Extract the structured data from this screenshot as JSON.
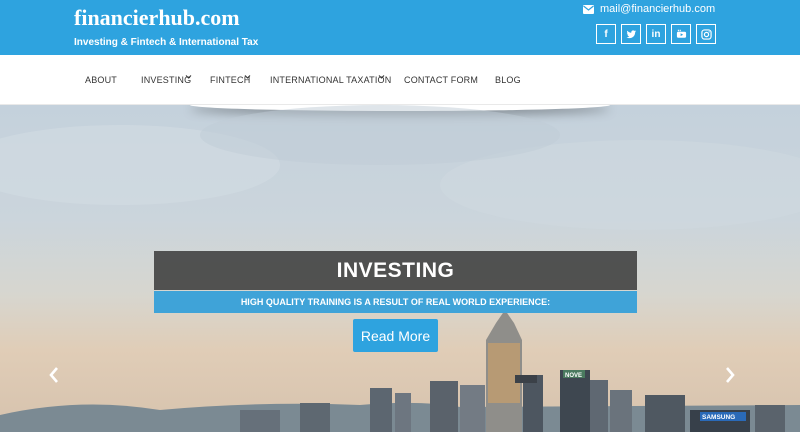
{
  "header": {
    "site_title": "financierhub.com",
    "tagline": "Investing & Fintech & International Tax",
    "email": "mail@financierhub.com",
    "socials": [
      {
        "name": "facebook-icon",
        "glyph": "f"
      },
      {
        "name": "twitter-icon",
        "glyph": ""
      },
      {
        "name": "linkedin-icon",
        "glyph": "in"
      },
      {
        "name": "youtube-icon",
        "glyph": ""
      },
      {
        "name": "instagram-icon",
        "glyph": ""
      }
    ],
    "accent_color": "#2ea3df"
  },
  "nav": {
    "items": [
      {
        "label": "ABOUT",
        "has_dropdown": false
      },
      {
        "label": "INVESTING",
        "has_dropdown": true
      },
      {
        "label": "FINTECH",
        "has_dropdown": true
      },
      {
        "label": "INTERNATIONAL TAXATION",
        "has_dropdown": true
      },
      {
        "label": "CONTACT FORM",
        "has_dropdown": false
      },
      {
        "label": "BLOG",
        "has_dropdown": false
      }
    ]
  },
  "slider": {
    "title": "INVESTING",
    "subtitle": "HIGH QUALITY TRAINING IS A RESULT OF REAL WORLD EXPERIENCE:",
    "button_label": "Read More",
    "prev_icon": "chevron-left-icon",
    "next_icon": "chevron-right-icon",
    "billboards": [
      "NOVE",
      "SAMSUNG"
    ]
  }
}
